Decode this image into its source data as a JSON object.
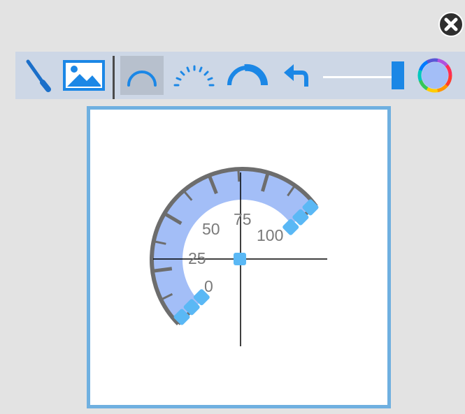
{
  "toolbar": {
    "tools": [
      {
        "id": "needle",
        "icon": "needle-icon"
      },
      {
        "id": "image",
        "icon": "image-icon"
      },
      {
        "id": "arc",
        "icon": "arc-icon",
        "active": true
      },
      {
        "id": "ticks",
        "icon": "dashed-arc-icon"
      },
      {
        "id": "thick-arc",
        "icon": "thick-arc-icon"
      },
      {
        "id": "undo",
        "icon": "undo-icon"
      },
      {
        "id": "color",
        "icon": "color-wheel-icon"
      }
    ],
    "slider_value": 1.0,
    "accent_color": "#1b87e6",
    "background_color": "#cdd7e6"
  },
  "gauge": {
    "tick_labels": [
      "0",
      "25",
      "50",
      "75",
      "100"
    ],
    "arc_color": "#a3bef7",
    "rim_color": "#6d6d6d",
    "handle_color": "#5ab8f5",
    "canvas_border_color": "#6fb0e0"
  }
}
